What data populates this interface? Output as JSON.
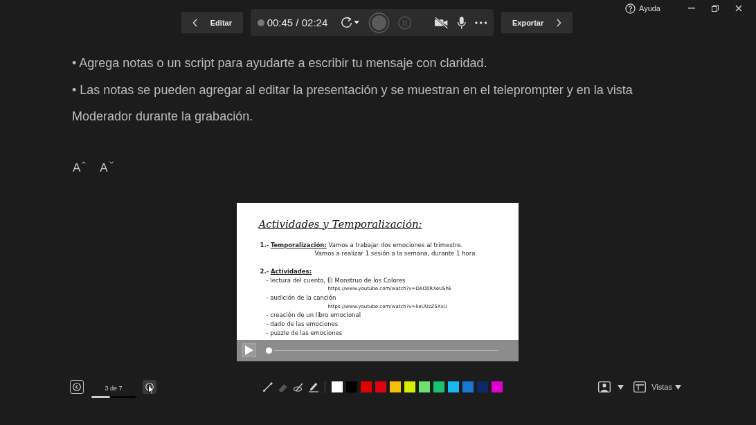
{
  "window": {
    "help_label": "Ayuda"
  },
  "toolbar": {
    "edit_label": "Editar",
    "timer": "00:45 / 02:24",
    "export_label": "Exportar"
  },
  "notes": [
    "• Agrega notas o un script para ayudarte a escribir tu mensaje con claridad.",
    "• Las notas se pueden agregar al editar la presentación y se muestran en el teleprompter y en la vista Moderador durante la grabación."
  ],
  "font_size_buttons": [
    {
      "label": "A",
      "kind": "increase"
    },
    {
      "label": "A",
      "kind": "decrease"
    }
  ],
  "slide": {
    "title": "Actividades y Temporalización:",
    "sections": [
      {
        "number": "1.-",
        "label": "Temporalización:",
        "text": "Vamos a trabajar dos emociones al trimestre.",
        "lines": [
          {
            "kind": "indent",
            "text": "Vamos a realizar 1 sesión a la semana, durante 1 hora."
          }
        ]
      },
      {
        "number": "2.-",
        "label": "Actividades:",
        "lines": [
          {
            "kind": "bullet",
            "text": "- lectura del cuento, El Monstruo de los Colores"
          },
          {
            "kind": "url",
            "text": "https://www.youtube.com/watch?v=DAO0RXeUShE"
          },
          {
            "kind": "bullet",
            "text": "- audición de la canción"
          },
          {
            "kind": "url",
            "text": "https://www.youtube.com/watch?v=lieUUzZ5XxU"
          },
          {
            "kind": "bullet",
            "text": "- creación de un libro emocional"
          },
          {
            "kind": "bullet",
            "text": "- dado de las emociones"
          },
          {
            "kind": "bullet",
            "text": "- puzzle de las emociones"
          }
        ]
      }
    ],
    "playing": false
  },
  "slide_nav": {
    "counter": "3 de 7",
    "level": 0.42
  },
  "pen_colors": [
    {
      "color": "#ffffff"
    },
    {
      "color": "#000000"
    },
    {
      "color": "#e00000"
    },
    {
      "color": "#e00010"
    },
    {
      "color": "#f5c000"
    },
    {
      "color": "#d4f000"
    },
    {
      "color": "#6ee06e"
    },
    {
      "color": "#18c070"
    },
    {
      "color": "#18b8f0"
    },
    {
      "color": "#1878d8"
    },
    {
      "color": "#0c2868"
    },
    {
      "color": "#e000d0"
    }
  ],
  "views": {
    "label": "Vistas"
  }
}
